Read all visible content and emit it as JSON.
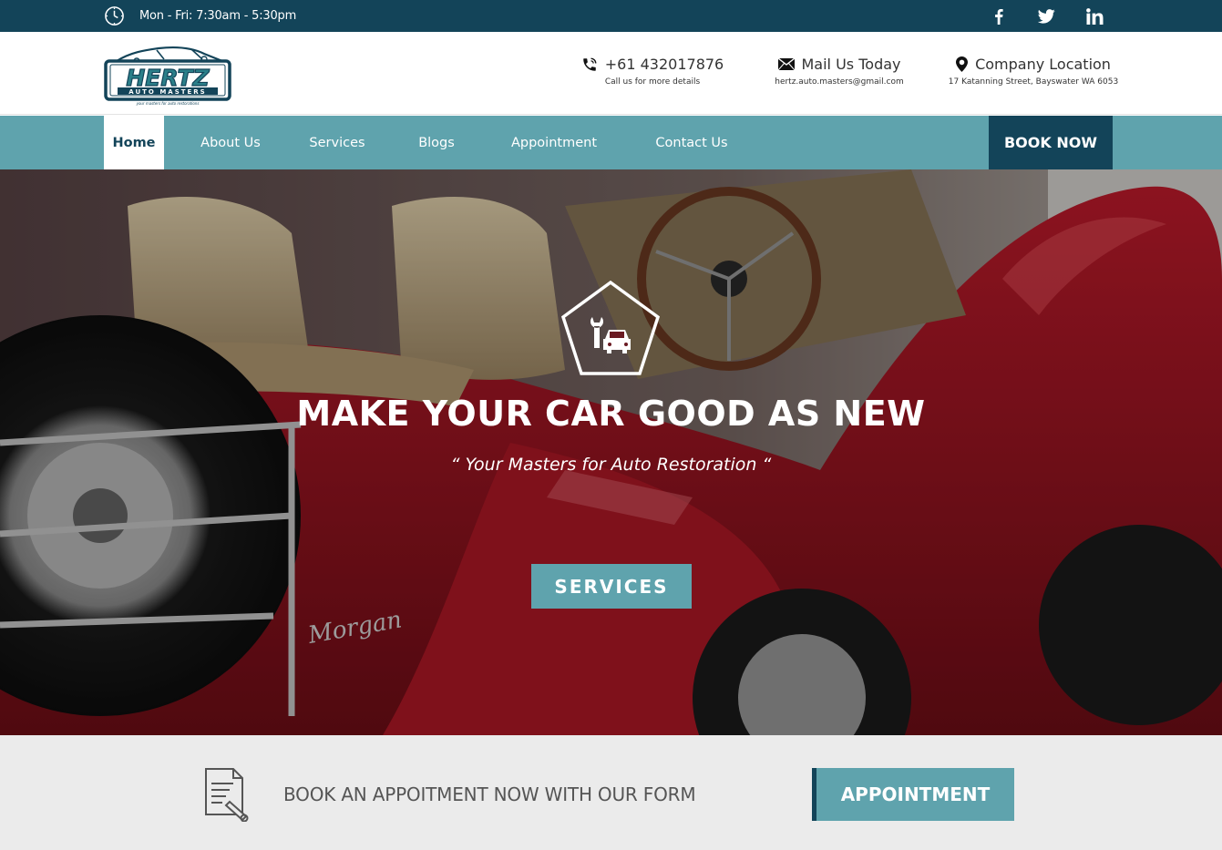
{
  "topbar": {
    "hours": "Mon - Fri: 7:30am - 5:30pm",
    "clock_icon": "clock-icon",
    "social": [
      "facebook-icon",
      "twitter-icon",
      "linkedin-icon"
    ]
  },
  "header": {
    "logo": {
      "name": "HERTZ",
      "tagline": "AUTO MASTERS",
      "slogan": "your masters for auto restorations"
    },
    "phone": {
      "label": "+61 432017876",
      "sub": "Call us for more details",
      "icon": "phone-icon"
    },
    "mail": {
      "label": "Mail Us Today",
      "sub": "hertz.auto.masters@gmail.com",
      "icon": "envelope-icon"
    },
    "location": {
      "label": "Company Location",
      "sub": "17 Katanning Street, Bayswater WA 6053",
      "icon": "map-pin-icon"
    }
  },
  "nav": {
    "items": [
      {
        "label": "Home",
        "active": true
      },
      {
        "label": "About Us",
        "active": false
      },
      {
        "label": "Services",
        "active": false
      },
      {
        "label": "Blogs",
        "active": false
      },
      {
        "label": "Appointment",
        "active": false
      },
      {
        "label": "Contact Us",
        "active": false
      }
    ],
    "book_now": "BOOK NOW"
  },
  "hero": {
    "icon": "car-repair-icon",
    "title": "MAKE YOUR CAR GOOD AS NEW",
    "subtitle": "“ Your Masters for Auto Restoration “",
    "button": "SERVICES"
  },
  "appointment": {
    "icon": "document-pen-icon",
    "text": "BOOK AN APPOITMENT NOW WITH OUR FORM",
    "button": "APPOINTMENT"
  },
  "colors": {
    "dark_teal": "#134459",
    "teal": "#5fa3ad",
    "light_gray": "#ebebeb"
  }
}
